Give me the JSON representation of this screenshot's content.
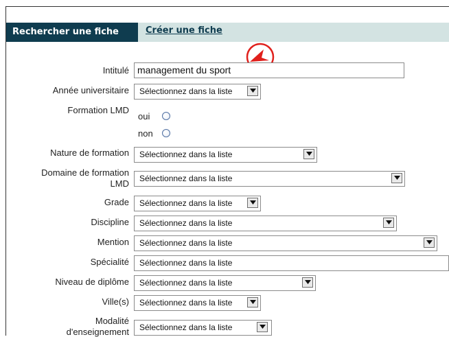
{
  "tabs": {
    "active": "Rechercher une fiche",
    "other": "Créer une fiche"
  },
  "form": {
    "intitule": {
      "label": "Intitulé",
      "value": "management du sport"
    },
    "annee": {
      "label": "Année universitaire",
      "value": "Sélectionnez dans la liste"
    },
    "formation_lmd": {
      "label": "Formation LMD",
      "option_yes": "oui",
      "option_no": "non"
    },
    "nature": {
      "label": "Nature de formation",
      "value": "Sélectionnez dans la liste"
    },
    "domaine": {
      "label_line1": "Domaine de formation",
      "label_line2": "LMD",
      "value": "Sélectionnez dans la liste"
    },
    "grade": {
      "label": "Grade",
      "value": "Sélectionnez dans la liste"
    },
    "discipline": {
      "label": "Discipline",
      "value": "Sélectionnez dans la liste"
    },
    "mention": {
      "label": "Mention",
      "value": "Sélectionnez dans la liste"
    },
    "specialite": {
      "label": "Spécialité",
      "value": "Sélectionnez dans la liste"
    },
    "niveau": {
      "label": "Niveau de diplôme",
      "value": "Sélectionnez dans la liste"
    },
    "villes": {
      "label": "Ville(s)",
      "value": "Sélectionnez dans la liste"
    },
    "modalite": {
      "label_line1": "Modalité",
      "label_line2": "d'enseignement",
      "value": "Sélectionnez dans la liste"
    }
  },
  "icons": {
    "cursor": "cursor-marker-icon",
    "dropdown": "chevron-down-icon"
  },
  "colors": {
    "tab_active_bg": "#0f3c4f",
    "tab_bar_bg": "#d3e3e2",
    "cursor_marker": "#e0201c"
  }
}
